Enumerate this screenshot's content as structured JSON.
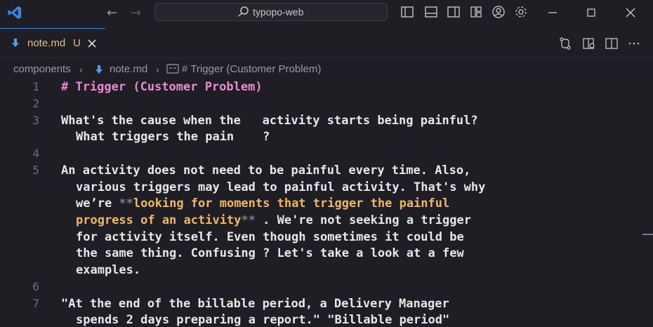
{
  "window": {
    "search_text": "typopo-web"
  },
  "tabs": [
    {
      "label": "note.md",
      "badge": "U"
    }
  ],
  "breadcrumb": {
    "folder": "components",
    "file": "note.md",
    "symbol": "# Trigger (Customer Problem)"
  },
  "editor": {
    "line_numbers": {
      "l1": "1",
      "l2": "2",
      "l3": "3",
      "l4": "4",
      "l5": "5",
      "l6": "6",
      "l7": "7"
    },
    "heading": "# Trigger (Customer Problem)",
    "line3a": "What's the cause when the   activity starts being painful?",
    "line3b": "What triggers the pain    ?",
    "line5a": "An activity does not need to be painful every time. Also,",
    "line5b": "various triggers may lead to painful activity. That's why",
    "line5c_pre": "we’re ",
    "line5c_mark": "**",
    "line5c_bold": "looking for moments that trigger the painful",
    "line5d_bold": "progress of an activity",
    "line5d_mark": "**",
    "line5d_post": " . We're not seeking a trigger",
    "line5e": "for activity itself. Even though sometimes it could be",
    "line5f": "the same thing. Confusing ? Let's take a look at a few",
    "line5g": "examples.",
    "line7a": "\"At the end of the billable period, a Delivery Manager",
    "line7b": "spends 2 days preparing a report.\" \"Billable period\""
  },
  "colors": {
    "accent": "#2f8ae0",
    "heading": "#e88bd0",
    "bold_text": "#f0b860",
    "modified": "#e0c080"
  }
}
